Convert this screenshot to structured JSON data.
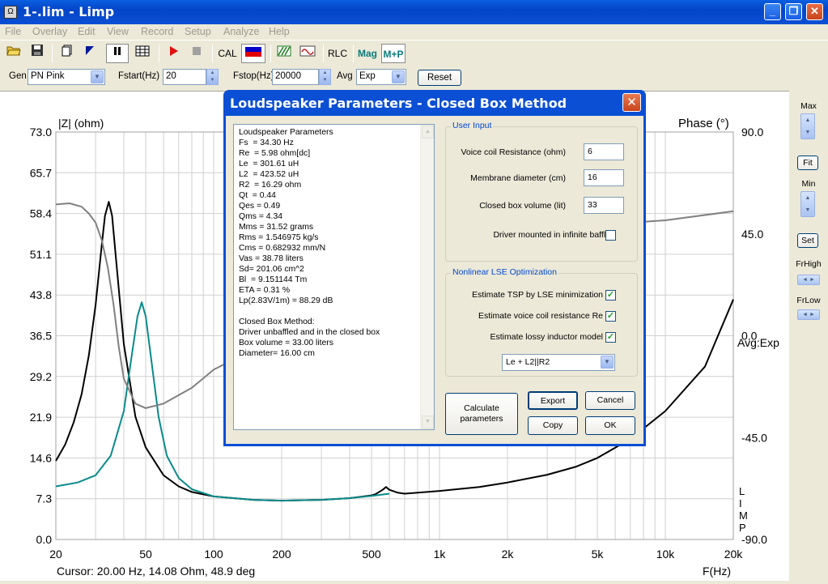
{
  "window": {
    "title": "1-.lim - Limp",
    "icon_label": "Ω"
  },
  "menu": [
    "File",
    "Overlay",
    "Edit",
    "View",
    "Record",
    "Setup",
    "Analyze",
    "Help"
  ],
  "toolbar": {
    "cal": "CAL",
    "rlc": "RLC",
    "mag": "Mag",
    "mp": "M+P"
  },
  "params": {
    "gen_label": "Gen",
    "gen_value": "PN Pink",
    "fstart_label": "Fstart(Hz)",
    "fstart_value": "20",
    "fstop_label": "Fstop(Hz)",
    "fstop_value": "20000",
    "avg_label": "Avg",
    "avg_value": "Exp",
    "reset": "Reset"
  },
  "right_panel": {
    "max": "Max",
    "fit": "Fit",
    "min": "Min",
    "set": "Set",
    "frhigh": "FrHigh",
    "frlow": "FrLow"
  },
  "chart_data": {
    "type": "line",
    "ylabel": "|Z| (ohm)",
    "ylabel_right": "Phase (°)",
    "xlabel": "F(Hz)",
    "x_scale": "log",
    "xlim": [
      20,
      20000
    ],
    "ylim": [
      0,
      73
    ],
    "y2lim": [
      -90,
      90
    ],
    "y_ticks": [
      "73.0",
      "65.7",
      "58.4",
      "51.1",
      "43.8",
      "36.5",
      "29.2",
      "21.9",
      "14.6",
      "7.3",
      "0.0"
    ],
    "y2_ticks": [
      "90.0",
      "45.0",
      "0.0",
      "-45.0",
      "-90.0"
    ],
    "x_ticks": [
      "20",
      "50",
      "100",
      "200",
      "500",
      "1k",
      "2k",
      "5k",
      "10k",
      "20k"
    ],
    "avg_label": "Avg:Exp",
    "side_label": "LIMP",
    "cursor": "Cursor: 20.00 Hz, 14.08 Ohm, 48.9 deg",
    "series": [
      {
        "color": "#000000",
        "axis": "left",
        "x": [
          20,
          22,
          24,
          26,
          28,
          30,
          32,
          33,
          34.3,
          35.5,
          37,
          40,
          45,
          50,
          60,
          70,
          80,
          100,
          150,
          200,
          300,
          400,
          500,
          520,
          560,
          580,
          600,
          650,
          700,
          1000,
          1500,
          2000,
          3000,
          4000,
          5000,
          7000,
          10000,
          15000,
          20000
        ],
        "y": [
          14.08,
          17,
          21,
          26,
          33,
          42,
          53,
          58,
          60.5,
          58,
          50,
          35,
          22,
          16.5,
          11.5,
          9.5,
          8.5,
          7.7,
          7.1,
          6.95,
          7.1,
          7.4,
          7.9,
          8.1,
          8.9,
          9.4,
          8.9,
          8.4,
          8.2,
          8.7,
          9.4,
          10.2,
          11.6,
          13,
          14.6,
          18,
          23,
          31,
          43
        ]
      },
      {
        "color": "#0a8a8a",
        "axis": "left",
        "x": [
          20,
          25,
          30,
          35,
          40,
          43,
          46,
          48,
          50,
          53,
          57,
          62,
          70,
          80,
          100,
          150,
          200,
          300,
          400,
          500,
          600
        ],
        "y": [
          9.5,
          10.2,
          11.5,
          15,
          23,
          32,
          40,
          42.5,
          40,
          32,
          22,
          15,
          11,
          9,
          7.7,
          7.1,
          6.95,
          7.1,
          7.4,
          7.8,
          8.2
        ]
      },
      {
        "color": "#808080",
        "axis": "right",
        "x": [
          20,
          23,
          26,
          28,
          30,
          32,
          34,
          36,
          38,
          40,
          45,
          50,
          60,
          80,
          100,
          150,
          200,
          250
        ],
        "y": [
          58,
          58.5,
          57,
          54,
          50,
          42,
          30,
          14,
          -5,
          -19,
          -30,
          -32,
          -30,
          -23,
          -15,
          -6,
          -1,
          1
        ]
      },
      {
        "color": "#808080",
        "axis": "right",
        "x": [
          640,
          800,
          1000,
          2000,
          5000,
          10000,
          20000
        ],
        "y": [
          45.5,
          46,
          46.5,
          47.5,
          49,
          51,
          55
        ]
      }
    ]
  },
  "dialog": {
    "title": "Loudspeaker Parameters - Closed Box Method",
    "results": [
      "Loudspeaker Parameters",
      "Fs  = 34.30 Hz",
      "Re  = 5.98 ohm[dc]",
      "Le  = 301.61 uH",
      "L2  = 423.52 uH",
      "R2  = 16.29 ohm",
      "Qt  = 0.44",
      "Qes = 0.49",
      "Qms = 4.34",
      "Mms = 31.52 grams",
      "Rms = 1.546975 kg/s",
      "Cms = 0.682932 mm/N",
      "Vas = 38.78 liters",
      "Sd= 201.06 cm^2",
      "Bl  = 9.151144 Tm",
      "ETA = 0.31 %",
      "Lp(2.83V/1m) = 88.29 dB",
      "",
      "Closed Box Method:",
      "Driver unbaffled and in the closed box",
      "Box volume = 33.00 liters",
      "Diameter= 16.00 cm"
    ],
    "user_input": {
      "group": "User Input",
      "vc_label": "Voice coil Resistance (ohm)",
      "vc_value": "6",
      "md_label": "Membrane diameter (cm)",
      "md_value": "16",
      "bv_label": "Closed box volume (lit)",
      "bv_value": "33",
      "baffle_label": "Driver mounted in infinite baffle"
    },
    "lse": {
      "group": "Nonlinear LSE Optimization",
      "tsp_label": "Estimate TSP by LSE minimization",
      "re_label": "Estimate voice coil resistance Re",
      "ind_label": "Estimate lossy inductor model",
      "model_value": "Le + L2||R2"
    },
    "buttons": {
      "calculate": "Calculate parameters",
      "export": "Export",
      "cancel": "Cancel",
      "copy": "Copy",
      "ok": "OK"
    }
  }
}
